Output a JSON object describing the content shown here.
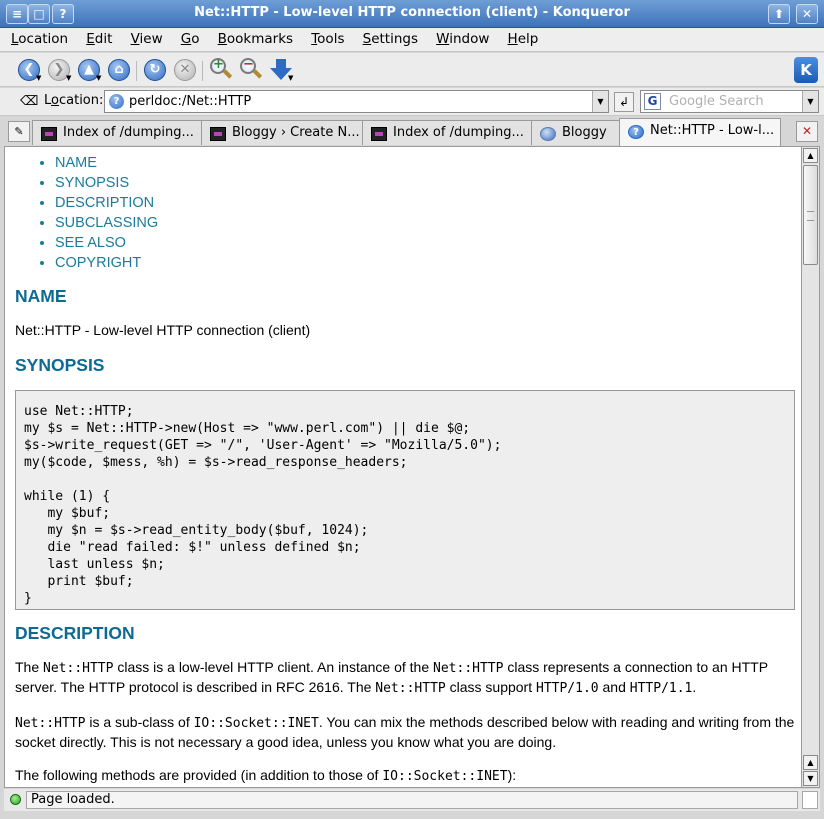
{
  "window": {
    "title": "Net::HTTP - Low-level HTTP connection (client) - Konqueror",
    "buttons": {
      "menu": "≡",
      "sticky": "□",
      "help": "?",
      "minimize": "⬆",
      "close": "✕"
    }
  },
  "menubar": [
    {
      "pre": "",
      "u": "L",
      "post": "ocation"
    },
    {
      "pre": "",
      "u": "E",
      "post": "dit"
    },
    {
      "pre": "",
      "u": "V",
      "post": "iew"
    },
    {
      "pre": "",
      "u": "G",
      "post": "o"
    },
    {
      "pre": "",
      "u": "B",
      "post": "ookmarks"
    },
    {
      "pre": "",
      "u": "T",
      "post": "ools"
    },
    {
      "pre": "",
      "u": "S",
      "post": "ettings"
    },
    {
      "pre": "",
      "u": "W",
      "post": "indow"
    },
    {
      "pre": "",
      "u": "H",
      "post": "elp"
    }
  ],
  "toolbar": {
    "icons": [
      "back-icon",
      "forward-icon",
      "up-icon",
      "home-icon",
      "reload-icon",
      "stop-icon",
      "zoom-in-icon",
      "zoom-out-icon",
      "download-icon"
    ],
    "glyphs": {
      "back": "❮",
      "forward": "❯",
      "up": "▲",
      "home": "⌂",
      "reload": "↻",
      "stop": "✕",
      "kde": "K"
    }
  },
  "location": {
    "label_u": "o",
    "label_pre": "L",
    "label_post": "cation:",
    "url": "perldoc:/Net::HTTP",
    "go_glyph": "↲",
    "search_placeholder": "Google Search",
    "search_glyph": "G"
  },
  "tabs": [
    {
      "label": "Index of /dumping...",
      "icon": "dark"
    },
    {
      "label": "Bloggy › Create N...",
      "icon": "dark"
    },
    {
      "label": "Index of /dumping...",
      "icon": "dark"
    },
    {
      "label": "Bloggy",
      "icon": "globe"
    },
    {
      "label": "Net::HTTP - Low-l...",
      "icon": "help",
      "active": true
    }
  ],
  "document": {
    "toc": [
      "NAME",
      "SYNOPSIS",
      "DESCRIPTION",
      "SUBCLASSING",
      "SEE ALSO",
      "COPYRIGHT"
    ],
    "name_heading": "NAME",
    "name_text": "Net::HTTP - Low-level HTTP connection (client)",
    "synopsis_heading": "SYNOPSIS",
    "synopsis_code": "use Net::HTTP;\nmy $s = Net::HTTP->new(Host => \"www.perl.com\") || die $@;\n$s->write_request(GET => \"/\", 'User-Agent' => \"Mozilla/5.0\");\nmy($code, $mess, %h) = $s->read_response_headers;\n\nwhile (1) {\n   my $buf;\n   my $n = $s->read_entity_body($buf, 1024);\n   die \"read failed: $!\" unless defined $n;\n   last unless $n;\n   print $buf;\n}",
    "description_heading": "DESCRIPTION",
    "desc_p1": {
      "t1": "The ",
      "c1": "Net::HTTP",
      "t2": " class is a low-level HTTP client. An instance of the ",
      "c2": "Net::HTTP",
      "t3": " class represents a connection to an HTTP server. The HTTP protocol is described in RFC 2616. The ",
      "c3": "Net::HTTP",
      "t4": " class support ",
      "c4": "HTTP/1.0",
      "t5": " and ",
      "c5": "HTTP/1.1",
      "t6": "."
    },
    "desc_p2": {
      "c1": "Net::HTTP",
      "t1": " is a sub-class of ",
      "c2": "IO::Socket::INET",
      "t2": ". You can mix the methods described below with reading and writing from the socket directly. This is not necessary a good idea, unless you know what you are doing."
    },
    "desc_p3": {
      "t1": "The following methods are provided (in addition to those of ",
      "c1": "IO::Socket::INET",
      "t2": "):"
    }
  },
  "scrollbar": {
    "up": "▲",
    "down": "▼"
  },
  "status": {
    "text": "Page loaded."
  }
}
